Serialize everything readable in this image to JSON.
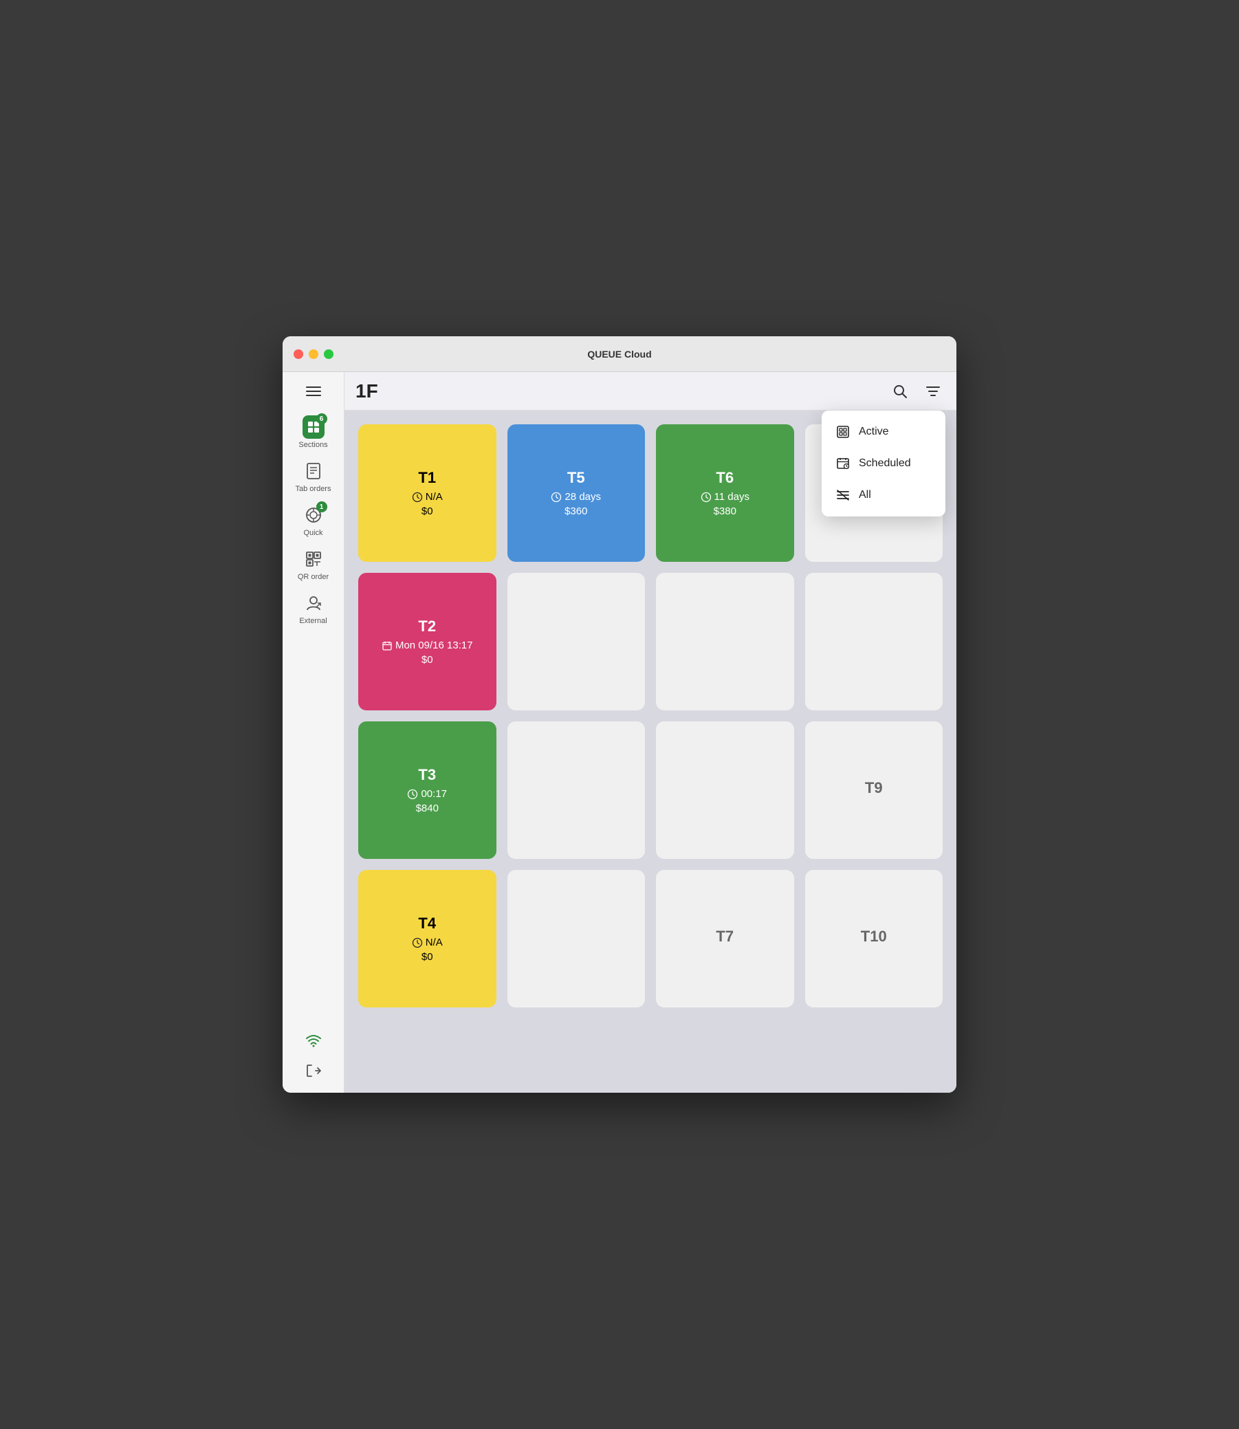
{
  "window": {
    "title": "QUEUE Cloud"
  },
  "sidebar": {
    "hamburger_label": "menu",
    "items": [
      {
        "id": "sections",
        "label": "Sections",
        "badge": "6",
        "active": true
      },
      {
        "id": "tab-orders",
        "label": "Tab orders",
        "badge": null
      },
      {
        "id": "quick",
        "label": "Quick",
        "badge": "1"
      },
      {
        "id": "qr-order",
        "label": "QR order",
        "badge": null
      },
      {
        "id": "external",
        "label": "External",
        "badge": null
      }
    ]
  },
  "topbar": {
    "floor": "1F"
  },
  "dropdown": {
    "items": [
      {
        "id": "active",
        "label": "Active"
      },
      {
        "id": "scheduled",
        "label": "Scheduled"
      },
      {
        "id": "all",
        "label": "All"
      }
    ]
  },
  "tables": [
    {
      "id": "T1",
      "name": "T1",
      "style": "yellow",
      "info_icon": "clock",
      "info": "N/A",
      "amount": "$0",
      "col": 1,
      "row": 1
    },
    {
      "id": "T5",
      "name": "T5",
      "style": "blue",
      "info_icon": "clock",
      "info": "28 days",
      "amount": "$360",
      "col": 2,
      "row": 1
    },
    {
      "id": "T6",
      "name": "T6",
      "style": "green",
      "info_icon": "clock",
      "info": "11 days",
      "amount": "$380",
      "col": 3,
      "row": 1
    },
    {
      "id": "T_empty1",
      "name": "",
      "style": "empty",
      "info_icon": null,
      "info": "",
      "amount": "",
      "col": 4,
      "row": 1
    },
    {
      "id": "T2",
      "name": "T2",
      "style": "pink",
      "info_icon": "calendar",
      "info": "Mon 09/16 13:17",
      "amount": "$0",
      "col": 1,
      "row": 2
    },
    {
      "id": "T_empty2",
      "name": "",
      "style": "empty",
      "col": 2,
      "row": 2,
      "info_icon": null,
      "info": "",
      "amount": ""
    },
    {
      "id": "T_empty3",
      "name": "",
      "style": "empty",
      "col": 3,
      "row": 2,
      "info_icon": null,
      "info": "",
      "amount": ""
    },
    {
      "id": "T_empty4",
      "name": "",
      "style": "empty",
      "col": 4,
      "row": 2,
      "info_icon": null,
      "info": "",
      "amount": ""
    },
    {
      "id": "T3",
      "name": "T3",
      "style": "green",
      "info_icon": "clock",
      "info": "00:17",
      "amount": "$840",
      "col": 1,
      "row": 3
    },
    {
      "id": "T_empty5",
      "name": "",
      "style": "empty",
      "col": 2,
      "row": 3,
      "info_icon": null,
      "info": "",
      "amount": ""
    },
    {
      "id": "T_empty6",
      "name": "",
      "style": "empty",
      "col": 3,
      "row": 3,
      "info_icon": null,
      "info": "",
      "amount": ""
    },
    {
      "id": "T9",
      "name": "T9",
      "style": "empty",
      "col": 4,
      "row": 3,
      "info_icon": null,
      "info": "",
      "amount": ""
    },
    {
      "id": "T4",
      "name": "T4",
      "style": "yellow",
      "info_icon": "clock",
      "info": "N/A",
      "amount": "$0",
      "col": 1,
      "row": 4
    },
    {
      "id": "T_empty7",
      "name": "",
      "style": "empty",
      "col": 2,
      "row": 4,
      "info_icon": null,
      "info": "",
      "amount": ""
    },
    {
      "id": "T7",
      "name": "T7",
      "style": "empty",
      "col": 3,
      "row": 4,
      "info_icon": null,
      "info": "",
      "amount": ""
    },
    {
      "id": "T10",
      "name": "T10",
      "style": "empty",
      "col": 4,
      "row": 4,
      "info_icon": null,
      "info": "",
      "amount": ""
    }
  ],
  "icons": {
    "search": "🔍",
    "filter": "⊟",
    "wifi": "wifi",
    "logout": "logout"
  }
}
